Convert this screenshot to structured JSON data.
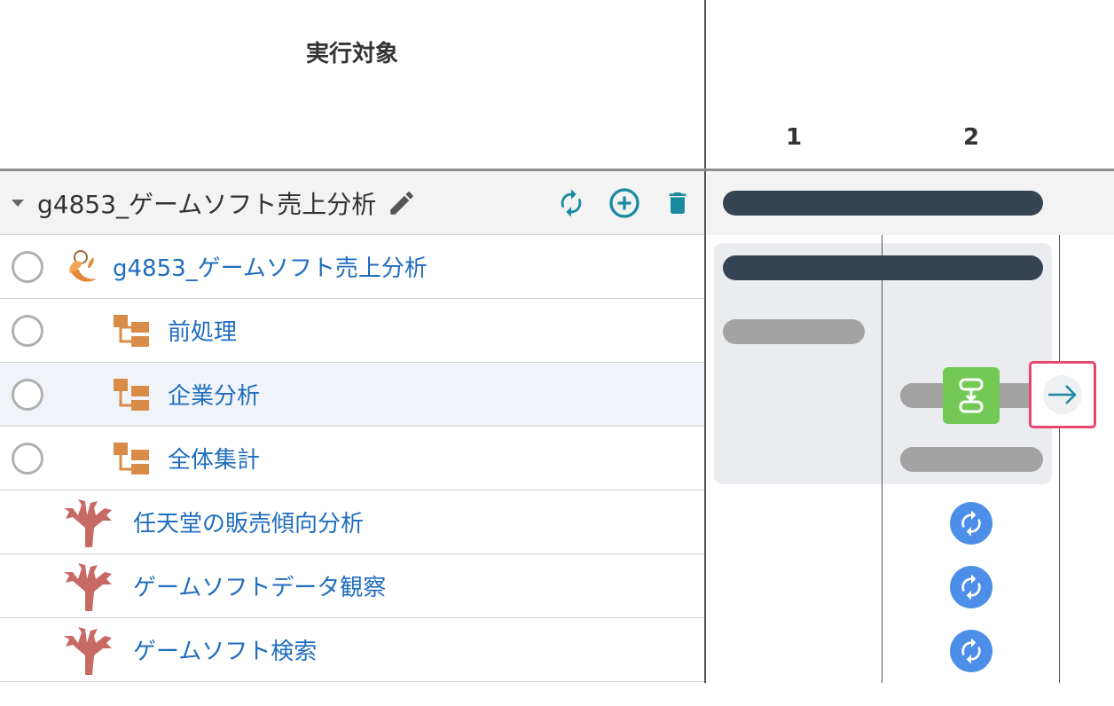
{
  "header": {
    "title": "実行対象",
    "columns": [
      "1",
      "2"
    ]
  },
  "group": {
    "name": "g4853_ゲームソフト売上分析"
  },
  "rows": [
    {
      "label": "g4853_ゲームソフト売上分析",
      "type": "workflow"
    },
    {
      "label": "前処理",
      "type": "sub"
    },
    {
      "label": "企業分析",
      "type": "sub"
    },
    {
      "label": "全体集計",
      "type": "sub"
    },
    {
      "label": "任天堂の販売傾向分析",
      "type": "coral"
    },
    {
      "label": "ゲームソフトデータ観察",
      "type": "coral"
    },
    {
      "label": "ゲームソフト検索",
      "type": "coral"
    }
  ],
  "colors": {
    "link": "#1f6dbf",
    "bar_dark": "#354453",
    "bar_gray": "#a3a3a3",
    "accent_teal": "#1a8aa0",
    "green": "#74c956",
    "highlight": "#e8466e",
    "sync_blue": "#4d8fe8",
    "coral": "#c86a64",
    "sub_icon": "#d98c47"
  }
}
